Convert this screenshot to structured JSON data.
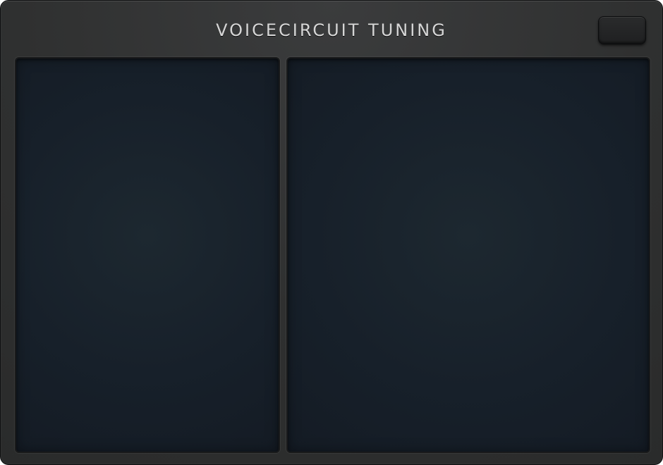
{
  "window": {
    "title": "VOICECIRCUIT TUNING"
  }
}
